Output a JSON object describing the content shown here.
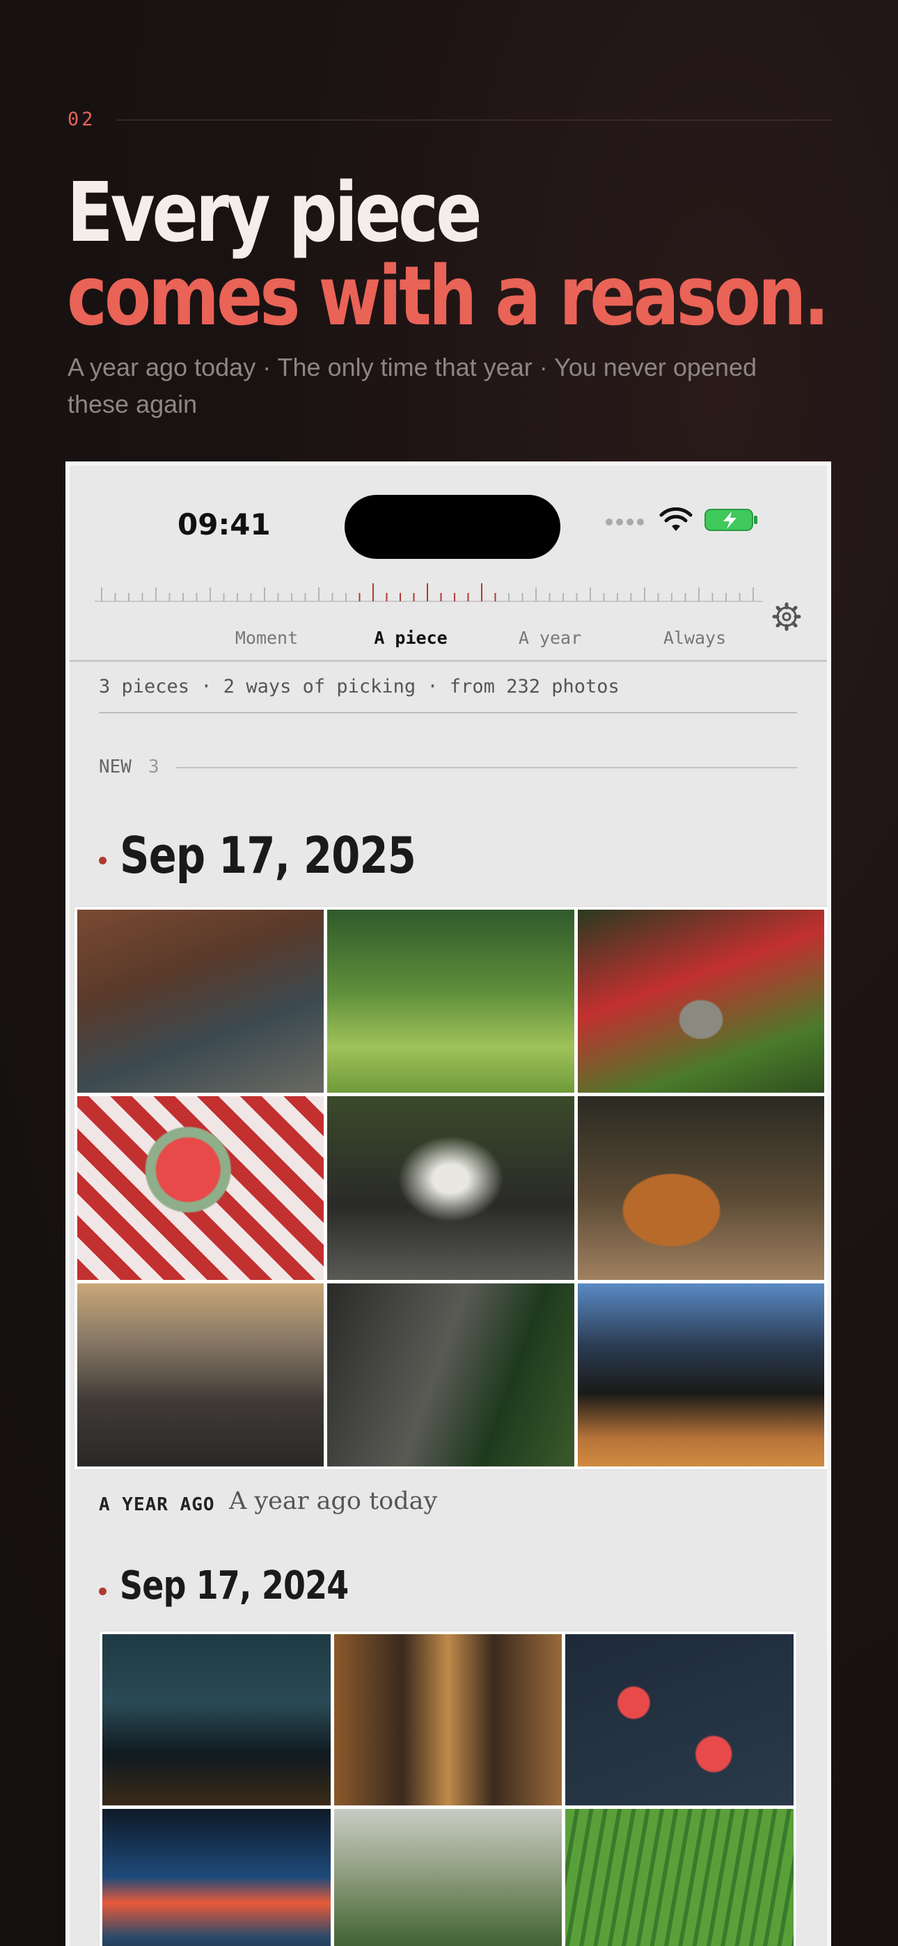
{
  "section": {
    "number": "02"
  },
  "headline": {
    "line1": "Every piece",
    "line2": "comes with a reason."
  },
  "subtitle": "A year ago today · The only time that year · You never opened these again",
  "status_bar": {
    "time": "09:41"
  },
  "tabs": [
    {
      "label": "Moment",
      "active": false
    },
    {
      "label": "A piece",
      "active": true
    },
    {
      "label": "A year",
      "active": false
    },
    {
      "label": "Always",
      "active": false
    }
  ],
  "summary": "3 pieces · 2 ways of picking · from 232 photos",
  "new_section": {
    "label": "NEW",
    "count": "3"
  },
  "groups": [
    {
      "date": "Sep 17, 2025",
      "photos": [
        {
          "name": "canal-bicycle-photo"
        },
        {
          "name": "sunlit-park-trees-photo"
        },
        {
          "name": "moss-path-red-leaves-photo"
        },
        {
          "name": "watermelon-picnic-photo"
        },
        {
          "name": "fountain-photo"
        },
        {
          "name": "iced-tea-cafe-photo"
        },
        {
          "name": "city-rooftops-photo"
        },
        {
          "name": "parked-bicycles-photo"
        },
        {
          "name": "night-basketball-court-photo"
        }
      ]
    },
    {
      "tag": "A YEAR AGO",
      "reason": "A year ago today",
      "date": "Sep 17, 2024",
      "photos": [
        {
          "name": "night-skyline-photo"
        },
        {
          "name": "lantern-alley-photo"
        },
        {
          "name": "red-leaves-water-photo"
        },
        {
          "name": "neon-storefront-photo"
        },
        {
          "name": "stone-lantern-garden-photo"
        },
        {
          "name": "green-fields-photo"
        }
      ]
    }
  ],
  "colors": {
    "accent": "#e96357",
    "background": "#1a1212",
    "screen": "#e8e8e8"
  }
}
